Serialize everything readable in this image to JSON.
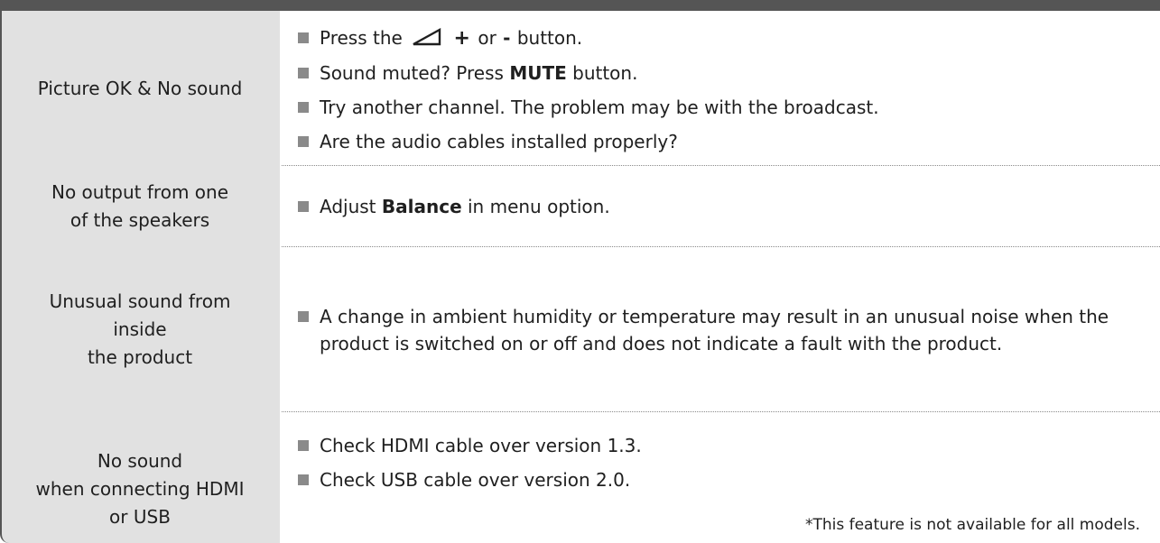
{
  "rows": [
    {
      "problem": "Picture OK & No sound",
      "solutions": {
        "r1_press": "Press the",
        "r1_plus": "+",
        "r1_or": "or",
        "r1_minus": "-",
        "r1_button": "button.",
        "r2_a": "Sound muted? Press",
        "r2_b": "MUTE",
        "r2_c": "button.",
        "r3": "Try another channel. The problem may be with the broadcast.",
        "r4": "Are the audio cables installed properly?"
      }
    },
    {
      "problem": "No output from one\nof the speakers",
      "solutions": {
        "a": "Adjust",
        "b": "Balance",
        "c": "in menu option."
      }
    },
    {
      "problem": "Unusual sound from\ninside\nthe product",
      "solutions": {
        "text": "A change in ambient humidity or temperature may result in an unusual noise when the product is switched on or off and does not indicate a fault with the product."
      }
    },
    {
      "problem": "No sound\nwhen connecting HDMI\nor USB",
      "solutions": {
        "r1": "Check HDMI cable over version 1.3.",
        "r2": "Check USB cable over version 2.0."
      },
      "footnote": "*This feature is not available for all models."
    }
  ],
  "icons": {
    "volume": "volume-triangle-icon",
    "bullet": "square-bullet-icon"
  },
  "colors": {
    "header_bar": "#555555",
    "problem_column": "#e1e1e1",
    "bullet": "#8a8a8a"
  }
}
